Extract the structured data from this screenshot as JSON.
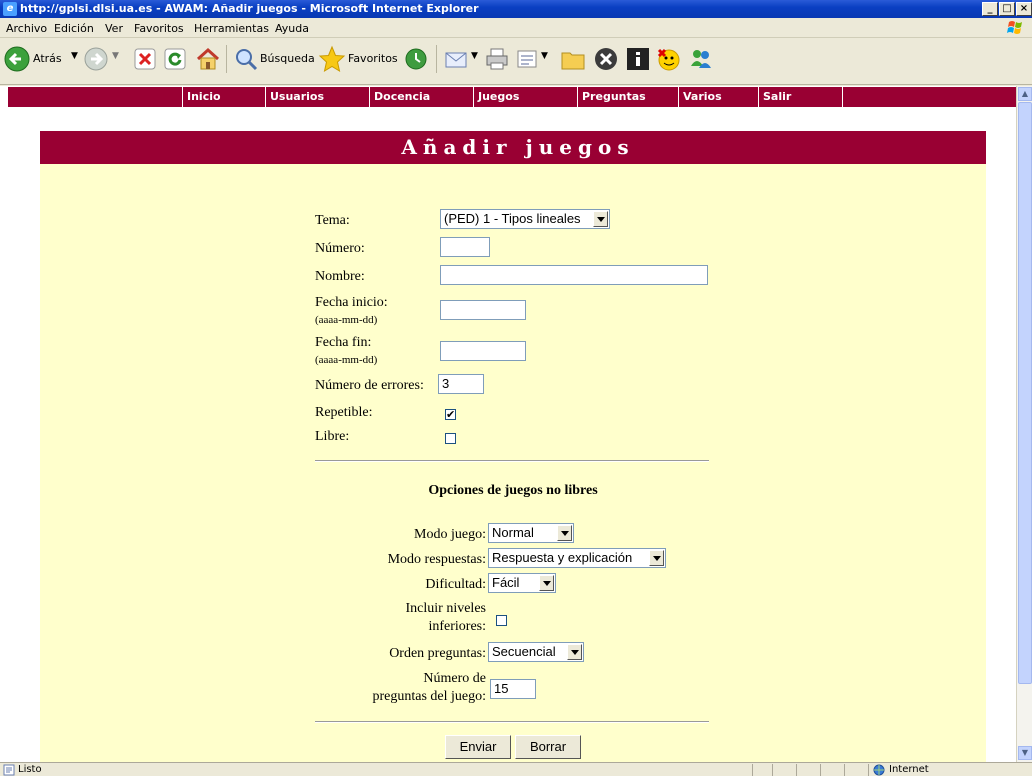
{
  "window": {
    "title": "http://gplsi.dlsi.ua.es - AWAM: Añadir juegos - Microsoft Internet Explorer",
    "minimize": "_",
    "maximize": "□",
    "close": "×"
  },
  "menu": [
    "Archivo",
    "Edición",
    "Ver",
    "Favoritos",
    "Herramientas",
    "Ayuda"
  ],
  "toolbar": {
    "back": "Atrás",
    "search": "Búsqueda",
    "favorites": "Favoritos"
  },
  "sitenav": [
    "Inicio",
    "Usuarios",
    "Docencia",
    "Juegos",
    "Preguntas",
    "Varios",
    "Salir"
  ],
  "page": {
    "title": "Añadir juegos",
    "fields": {
      "tema_label": "Tema:",
      "tema_value": "(PED) 1 - Tipos lineales",
      "numero_label": "Número:",
      "numero_value": "",
      "nombre_label": "Nombre:",
      "nombre_value": "",
      "fecha_inicio_label": "Fecha inicio:",
      "fecha_inicio_hint": "(aaaa-mm-dd)",
      "fecha_inicio_value": "",
      "fecha_fin_label": "Fecha fin:",
      "fecha_fin_hint": "(aaaa-mm-dd)",
      "fecha_fin_value": "",
      "errores_label": "Número de errores:",
      "errores_value": "3",
      "repetible_label": "Repetible:",
      "repetible_checked": true,
      "libre_label": "Libre:",
      "libre_checked": false
    },
    "options_heading": "Opciones de juegos no libres",
    "options": {
      "modo_juego_label": "Modo juego:",
      "modo_juego_value": "Normal",
      "modo_respuestas_label": "Modo respuestas:",
      "modo_respuestas_value": "Respuesta y explicación",
      "dificultad_label": "Dificultad:",
      "dificultad_value": "Fácil",
      "incluir_label_1": "Incluir niveles",
      "incluir_label_2": "inferiores:",
      "incluir_checked": false,
      "orden_label": "Orden preguntas:",
      "orden_value": "Secuencial",
      "num_preguntas_label_1": "Número de",
      "num_preguntas_label_2": "preguntas del juego:",
      "num_preguntas_value": "15"
    },
    "buttons": {
      "submit": "Enviar",
      "reset": "Borrar"
    }
  },
  "status": {
    "text": "Listo",
    "zone": "Internet"
  }
}
